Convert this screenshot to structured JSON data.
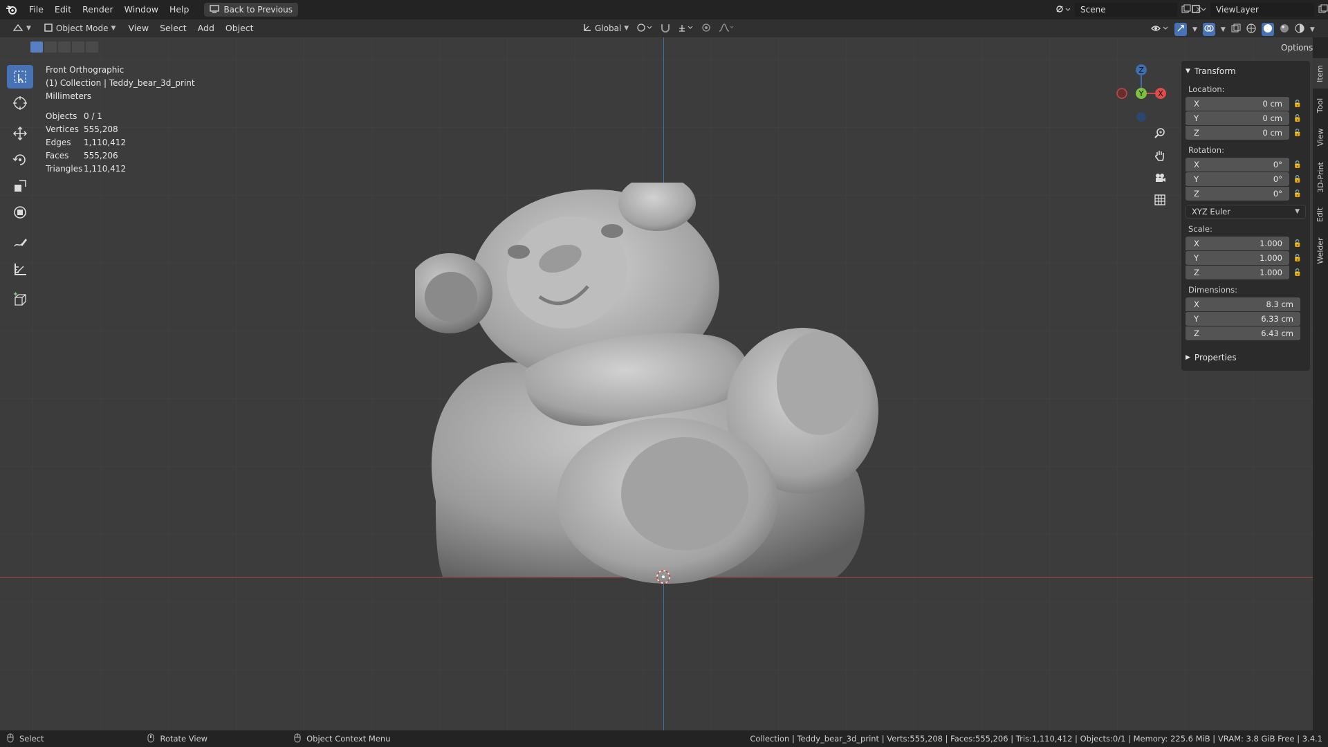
{
  "menubar": {
    "items": [
      "File",
      "Edit",
      "Render",
      "Window",
      "Help"
    ],
    "back_button": "Back to Previous",
    "scene": "Scene",
    "view_layer": "ViewLayer"
  },
  "header": {
    "mode": "Object Mode",
    "menus": [
      "View",
      "Select",
      "Add",
      "Object"
    ],
    "orientation": "Global",
    "options": "Options"
  },
  "viewport_info": {
    "view_name": "Front Orthographic",
    "collection": "(1) Collection | Teddy_bear_3d_print",
    "units": "Millimeters",
    "stats": [
      {
        "label": "Objects",
        "value": "0 / 1"
      },
      {
        "label": "Vertices",
        "value": "555,208"
      },
      {
        "label": "Edges",
        "value": "1,110,412"
      },
      {
        "label": "Faces",
        "value": "555,206"
      },
      {
        "label": "Triangles",
        "value": "1,110,412"
      }
    ]
  },
  "gizmo": {
    "x": "X",
    "y": "Y",
    "z": "Z"
  },
  "transform": {
    "title": "Transform",
    "location_label": "Location:",
    "location": [
      {
        "axis": "X",
        "value": "0 cm"
      },
      {
        "axis": "Y",
        "value": "0 cm"
      },
      {
        "axis": "Z",
        "value": "0 cm"
      }
    ],
    "rotation_label": "Rotation:",
    "rotation": [
      {
        "axis": "X",
        "value": "0°"
      },
      {
        "axis": "Y",
        "value": "0°"
      },
      {
        "axis": "Z",
        "value": "0°"
      }
    ],
    "rotation_mode": "XYZ Euler",
    "scale_label": "Scale:",
    "scale": [
      {
        "axis": "X",
        "value": "1.000"
      },
      {
        "axis": "Y",
        "value": "1.000"
      },
      {
        "axis": "Z",
        "value": "1.000"
      }
    ],
    "dimensions_label": "Dimensions:",
    "dimensions": [
      {
        "axis": "X",
        "value": "8.3 cm"
      },
      {
        "axis": "Y",
        "value": "6.33 cm"
      },
      {
        "axis": "Z",
        "value": "6.43 cm"
      }
    ],
    "properties": "Properties"
  },
  "side_tabs": [
    "Item",
    "Tool",
    "View",
    "3D-Print",
    "Edit",
    "Welder"
  ],
  "statusbar": {
    "hints": [
      "Select",
      "Rotate View",
      "Object Context Menu"
    ],
    "info": "Collection | Teddy_bear_3d_print | Verts:555,208 | Faces:555,206 | Tris:1,110,412 | Objects:0/1 | Memory: 225.6 MiB | VRAM: 3.8 GiB Free | 3.4.1"
  },
  "colors": {
    "accent": "#4772b3",
    "axis_x": "#a64848",
    "axis_z": "#3f6db0",
    "viewport": "#3c3c3c"
  }
}
